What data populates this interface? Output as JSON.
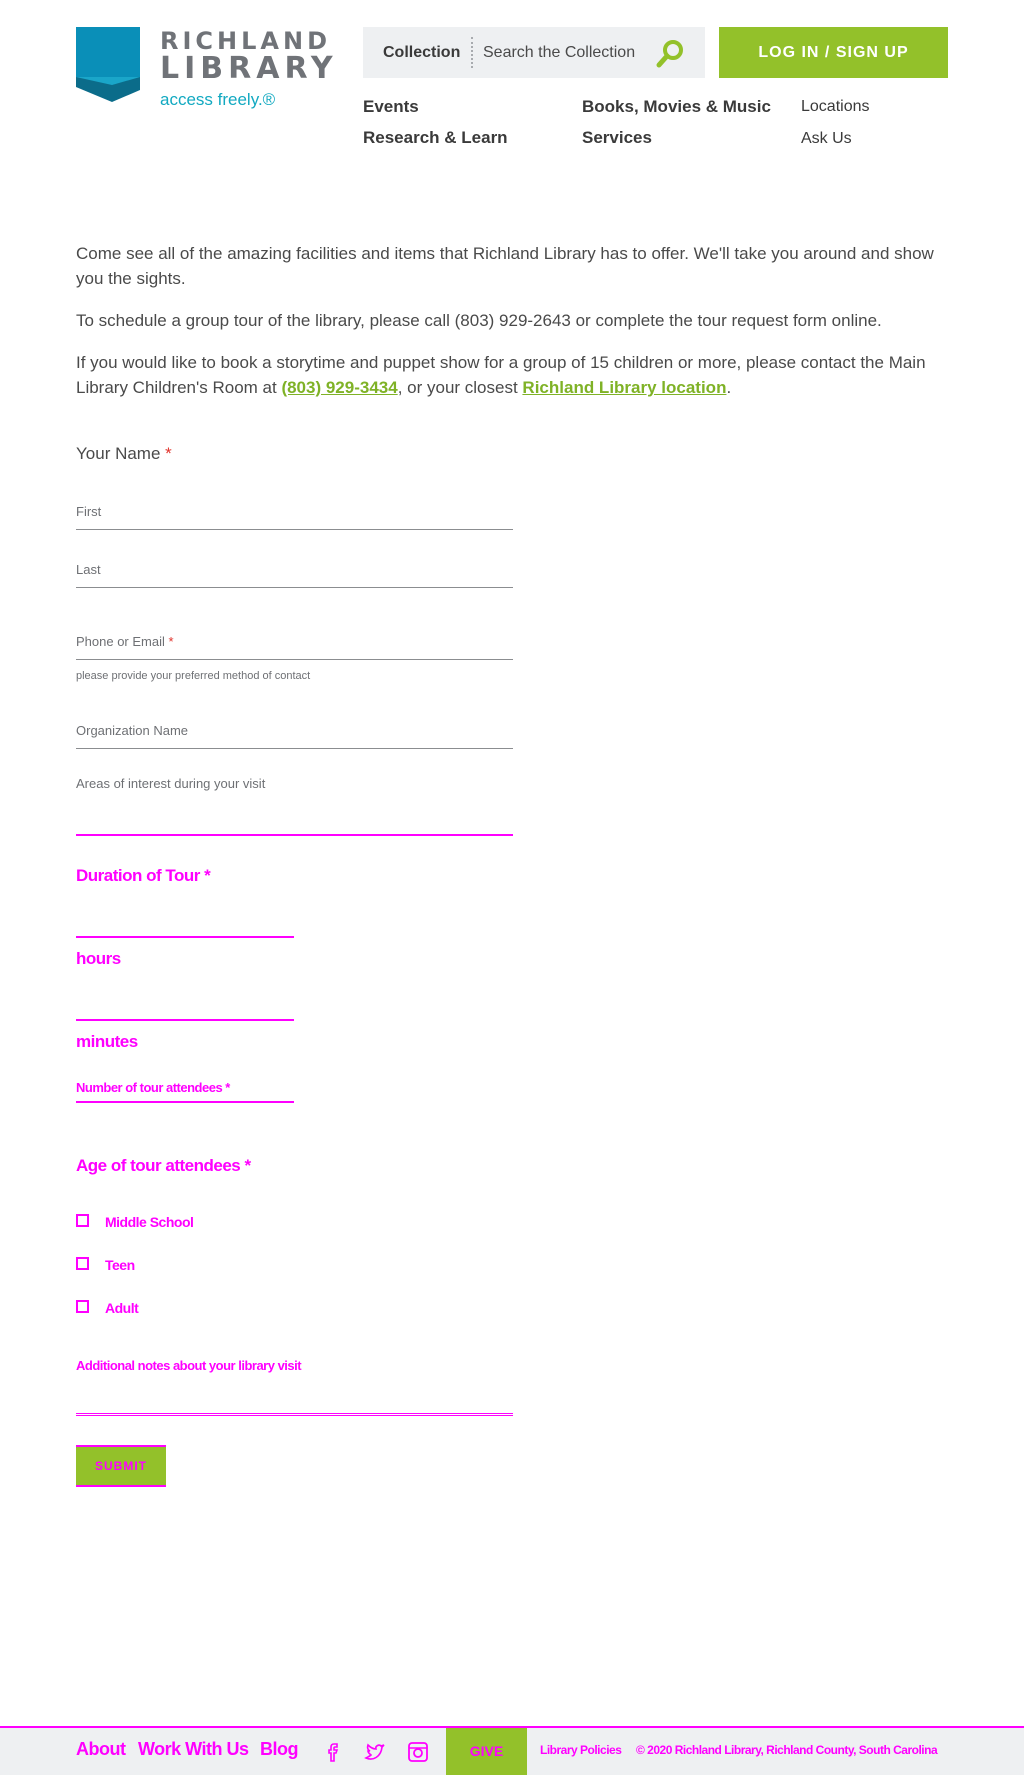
{
  "header": {
    "logo": {
      "line1": "RICHLAND",
      "line2": "LIBRARY",
      "tagline": "access freely.®"
    },
    "search": {
      "scope": "Collection",
      "placeholder": "Search the Collection"
    },
    "login_label": "LOG IN / SIGN UP",
    "nav": {
      "events": "Events",
      "research": "Research & Learn",
      "books": "Books, Movies & Music",
      "services": "Services",
      "locations": "Locations",
      "ask": "Ask Us"
    }
  },
  "intro": {
    "p1": "Come see all of the amazing facilities and items that Richland Library has to offer. We'll take you around and show you the sights.",
    "p2": "To schedule a group tour of the library, please call (803) 929-2643 or complete the tour request form online.",
    "p3_before": "If you would like to book a storytime and puppet show for a group of 15 children or more, please contact the Main Library Children's Room at ",
    "p3_phone": "(803) 929-3434",
    "p3_middle": ", or your closest ",
    "p3_link": "Richland Library location",
    "p3_after": "."
  },
  "form": {
    "name_label": "Your Name",
    "required_mark": "*",
    "first_placeholder": "First",
    "last_placeholder": "Last",
    "contact_label": "Phone or Email",
    "contact_hint": "please provide your preferred method of contact",
    "org_label": "Organization Name",
    "areas_label": "Areas of interest during your visit",
    "duration_label": "Duration of Tour *",
    "hours_label": "hours",
    "minutes_label": "minutes",
    "attendees_label": "Number of tour attendees *",
    "age_label": "Age of tour attendees *",
    "age_options": [
      "Middle School",
      "Teen",
      "Adult"
    ],
    "notes_label": "Additional notes about your library visit",
    "submit_label": "SUBMIT"
  },
  "footer": {
    "about": "About",
    "work": "Work With Us",
    "blog": "Blog",
    "icons": [
      "facebook-icon",
      "twitter-icon",
      "instagram-icon"
    ],
    "give": "GIVE",
    "policies": "Library Policies",
    "copyright": "© 2020 Richland Library, Richland County, South Carolina"
  },
  "colors": {
    "brand_green": "#93c12a",
    "brand_teal": "#12a9c1",
    "required_red": "#e0322b",
    "highlight_magenta": "#ff00ff"
  }
}
